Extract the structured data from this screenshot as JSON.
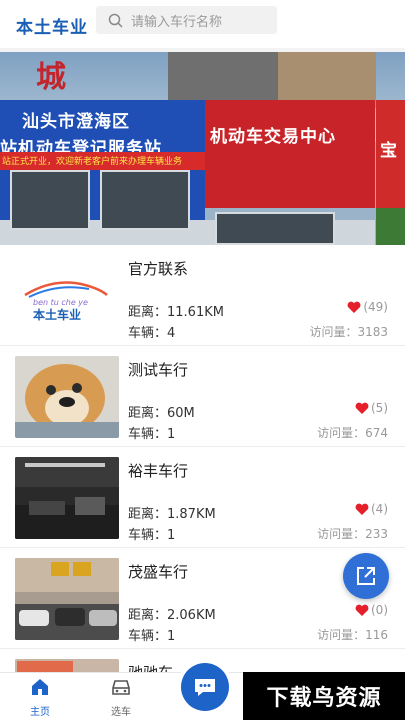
{
  "header": {
    "logo": "本土车业",
    "search_placeholder": "请输入车行名称"
  },
  "banner": {
    "top_sign": "城",
    "blue_line1": "汕头市澄海区",
    "blue_line2": "站机动车登记服务站",
    "red_strip": "站正式开业，欢迎新老客户前来办理车辆业务",
    "red_sign": "机动车交易中心",
    "right_sign": "宝"
  },
  "dealers": [
    {
      "name": "官方联系",
      "distance": "距离：11.61KM",
      "cars": "车辆：4",
      "likes": "(49)",
      "visits": "访问量：3183",
      "thumb": "logo",
      "logo_small": "ben tu che ye",
      "logo_big": "本土车业"
    },
    {
      "name": "测试车行",
      "distance": "距离：60M",
      "cars": "车辆：1",
      "likes": "(5)",
      "visits": "访问量：674",
      "thumb": "dog"
    },
    {
      "name": "裕丰车行",
      "distance": "距离：1.87KM",
      "cars": "车辆：1",
      "likes": "(4)",
      "visits": "访问量：233",
      "thumb": "garage"
    },
    {
      "name": "茂盛车行",
      "distance": "距离：2.06KM",
      "cars": "车辆：1",
      "likes": "(0)",
      "visits": "访问量：116",
      "thumb": "street"
    },
    {
      "name": "驰驰车",
      "distance": "",
      "cars": "",
      "likes": "",
      "visits": "",
      "thumb": "partial"
    }
  ],
  "tabs": {
    "home": "主页",
    "cars": "选车"
  },
  "watermark": "下载鸟资源",
  "colors": {
    "brand_blue": "#1d63c8",
    "heart_red": "#e5202a"
  }
}
